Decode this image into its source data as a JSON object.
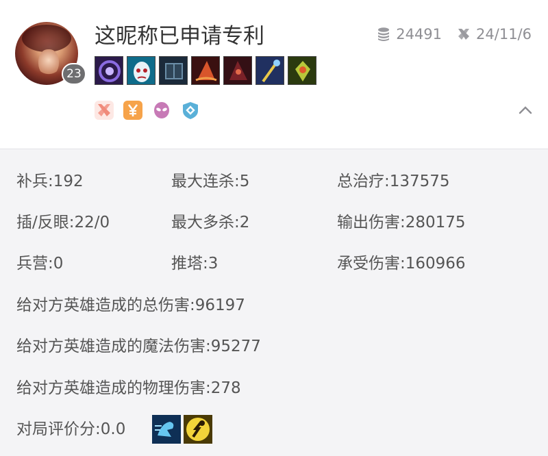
{
  "profile": {
    "nickname": "这昵称已申请专利",
    "level": "23",
    "gold": "24491",
    "date": "24/11/6",
    "avatar_icon": "champion-portrait"
  },
  "items": [
    {
      "icon": "purple-orb-item",
      "colors": [
        "#2b1a4a",
        "#8a6be0"
      ]
    },
    {
      "icon": "mask-item",
      "colors": [
        "#0f6c8a",
        "#cfe6f2"
      ]
    },
    {
      "icon": "dark-tome-item",
      "colors": [
        "#1b2a3a",
        "#4d6f86"
      ]
    },
    {
      "icon": "wizard-hat-item",
      "colors": [
        "#3a1010",
        "#d8552b"
      ]
    },
    {
      "icon": "dark-hat-item",
      "colors": [
        "#341015",
        "#a83a3a"
      ]
    },
    {
      "icon": "staff-item",
      "colors": [
        "#203060",
        "#e8c84a"
      ]
    },
    {
      "icon": "green-crest-item",
      "colors": [
        "#2b3a0f",
        "#b8c83a"
      ]
    }
  ],
  "tags": [
    {
      "icon": "crossed-swords-tag",
      "color": "#f08a7a"
    },
    {
      "icon": "yen-tag",
      "color": "#f6a34a"
    },
    {
      "icon": "alien-tag",
      "color": "#c77ab6"
    },
    {
      "icon": "shield-tag",
      "color": "#5ab0d8"
    }
  ],
  "stats": {
    "cs": "补兵:192",
    "max_streak": "最大连杀:5",
    "total_heal": "总治疗:137575",
    "wards": "插/反眼:22/0",
    "max_multi": "最大多杀:2",
    "damage_dealt": "输出伤害:280175",
    "barracks": "兵营:0",
    "towers": "推塔:3",
    "damage_taken": "承受伤害:160966",
    "champ_total_dmg": "给对方英雄造成的总伤害:96197",
    "champ_magic_dmg": "给对方英雄造成的魔法伤害:95277",
    "champ_phys_dmg": "给对方英雄造成的物理伤害:278",
    "rating": "对局评价分:0.0"
  },
  "skills": [
    {
      "icon": "ghost-spell-icon",
      "colors": [
        "#0e2f55",
        "#66c6f0"
      ]
    },
    {
      "icon": "flash-spell-icon",
      "colors": [
        "#4a3a05",
        "#f2d43a"
      ]
    }
  ]
}
